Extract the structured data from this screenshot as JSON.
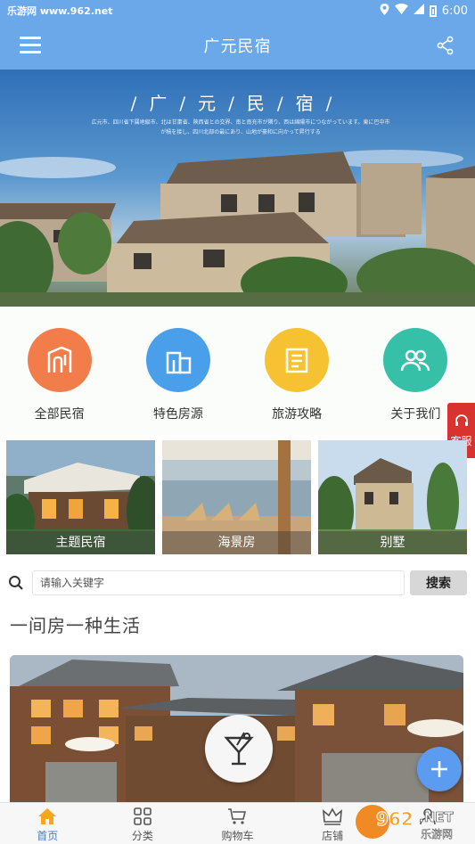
{
  "status_bar": {
    "left_text": "乐游网 www.962.net",
    "time": "6:00"
  },
  "app_bar": {
    "title": "广元民宿"
  },
  "hero": {
    "title": "/广/元/民/宿/",
    "subtitle": "広元市、四川省下属地級市、北は甘粛省、陝西省との交界、南と南充市が隣り、西は綿陽市につながっています。東に巴中市が積を接し、四川北部の最にあり、山地が豪和に向かって昇行する"
  },
  "categories": [
    {
      "label": "全部民宿",
      "color": "#f37d4a",
      "icon": "building-arch-icon"
    },
    {
      "label": "特色房源",
      "color": "#4a9fea",
      "icon": "buildings-icon"
    },
    {
      "label": "旅游攻略",
      "color": "#f6c231",
      "icon": "document-icon"
    },
    {
      "label": "关于我们",
      "color": "#36c0a7",
      "icon": "group-icon"
    }
  ],
  "service_tab": {
    "label": "客服"
  },
  "types": [
    {
      "label": "主题民宿"
    },
    {
      "label": "海景房"
    },
    {
      "label": "别墅"
    }
  ],
  "search": {
    "placeholder": "请输入关键字",
    "button": "搜索"
  },
  "section": {
    "title": "一间房一种生活"
  },
  "bottom_nav": [
    {
      "label": "首页",
      "icon": "home-icon",
      "active": true
    },
    {
      "label": "分类",
      "icon": "grid-icon",
      "active": false
    },
    {
      "label": "购物车",
      "icon": "cart-icon",
      "active": false
    },
    {
      "label": "店铺",
      "icon": "crown-icon",
      "active": false
    },
    {
      "label": "",
      "icon": "user-icon",
      "active": false
    }
  ],
  "watermark": {
    "brand": "962.NET",
    "sub": "乐游网"
  },
  "colors": {
    "primary": "#6aa8ea",
    "service_red": "#d9332f",
    "fab_blue": "#5c9cf0"
  }
}
